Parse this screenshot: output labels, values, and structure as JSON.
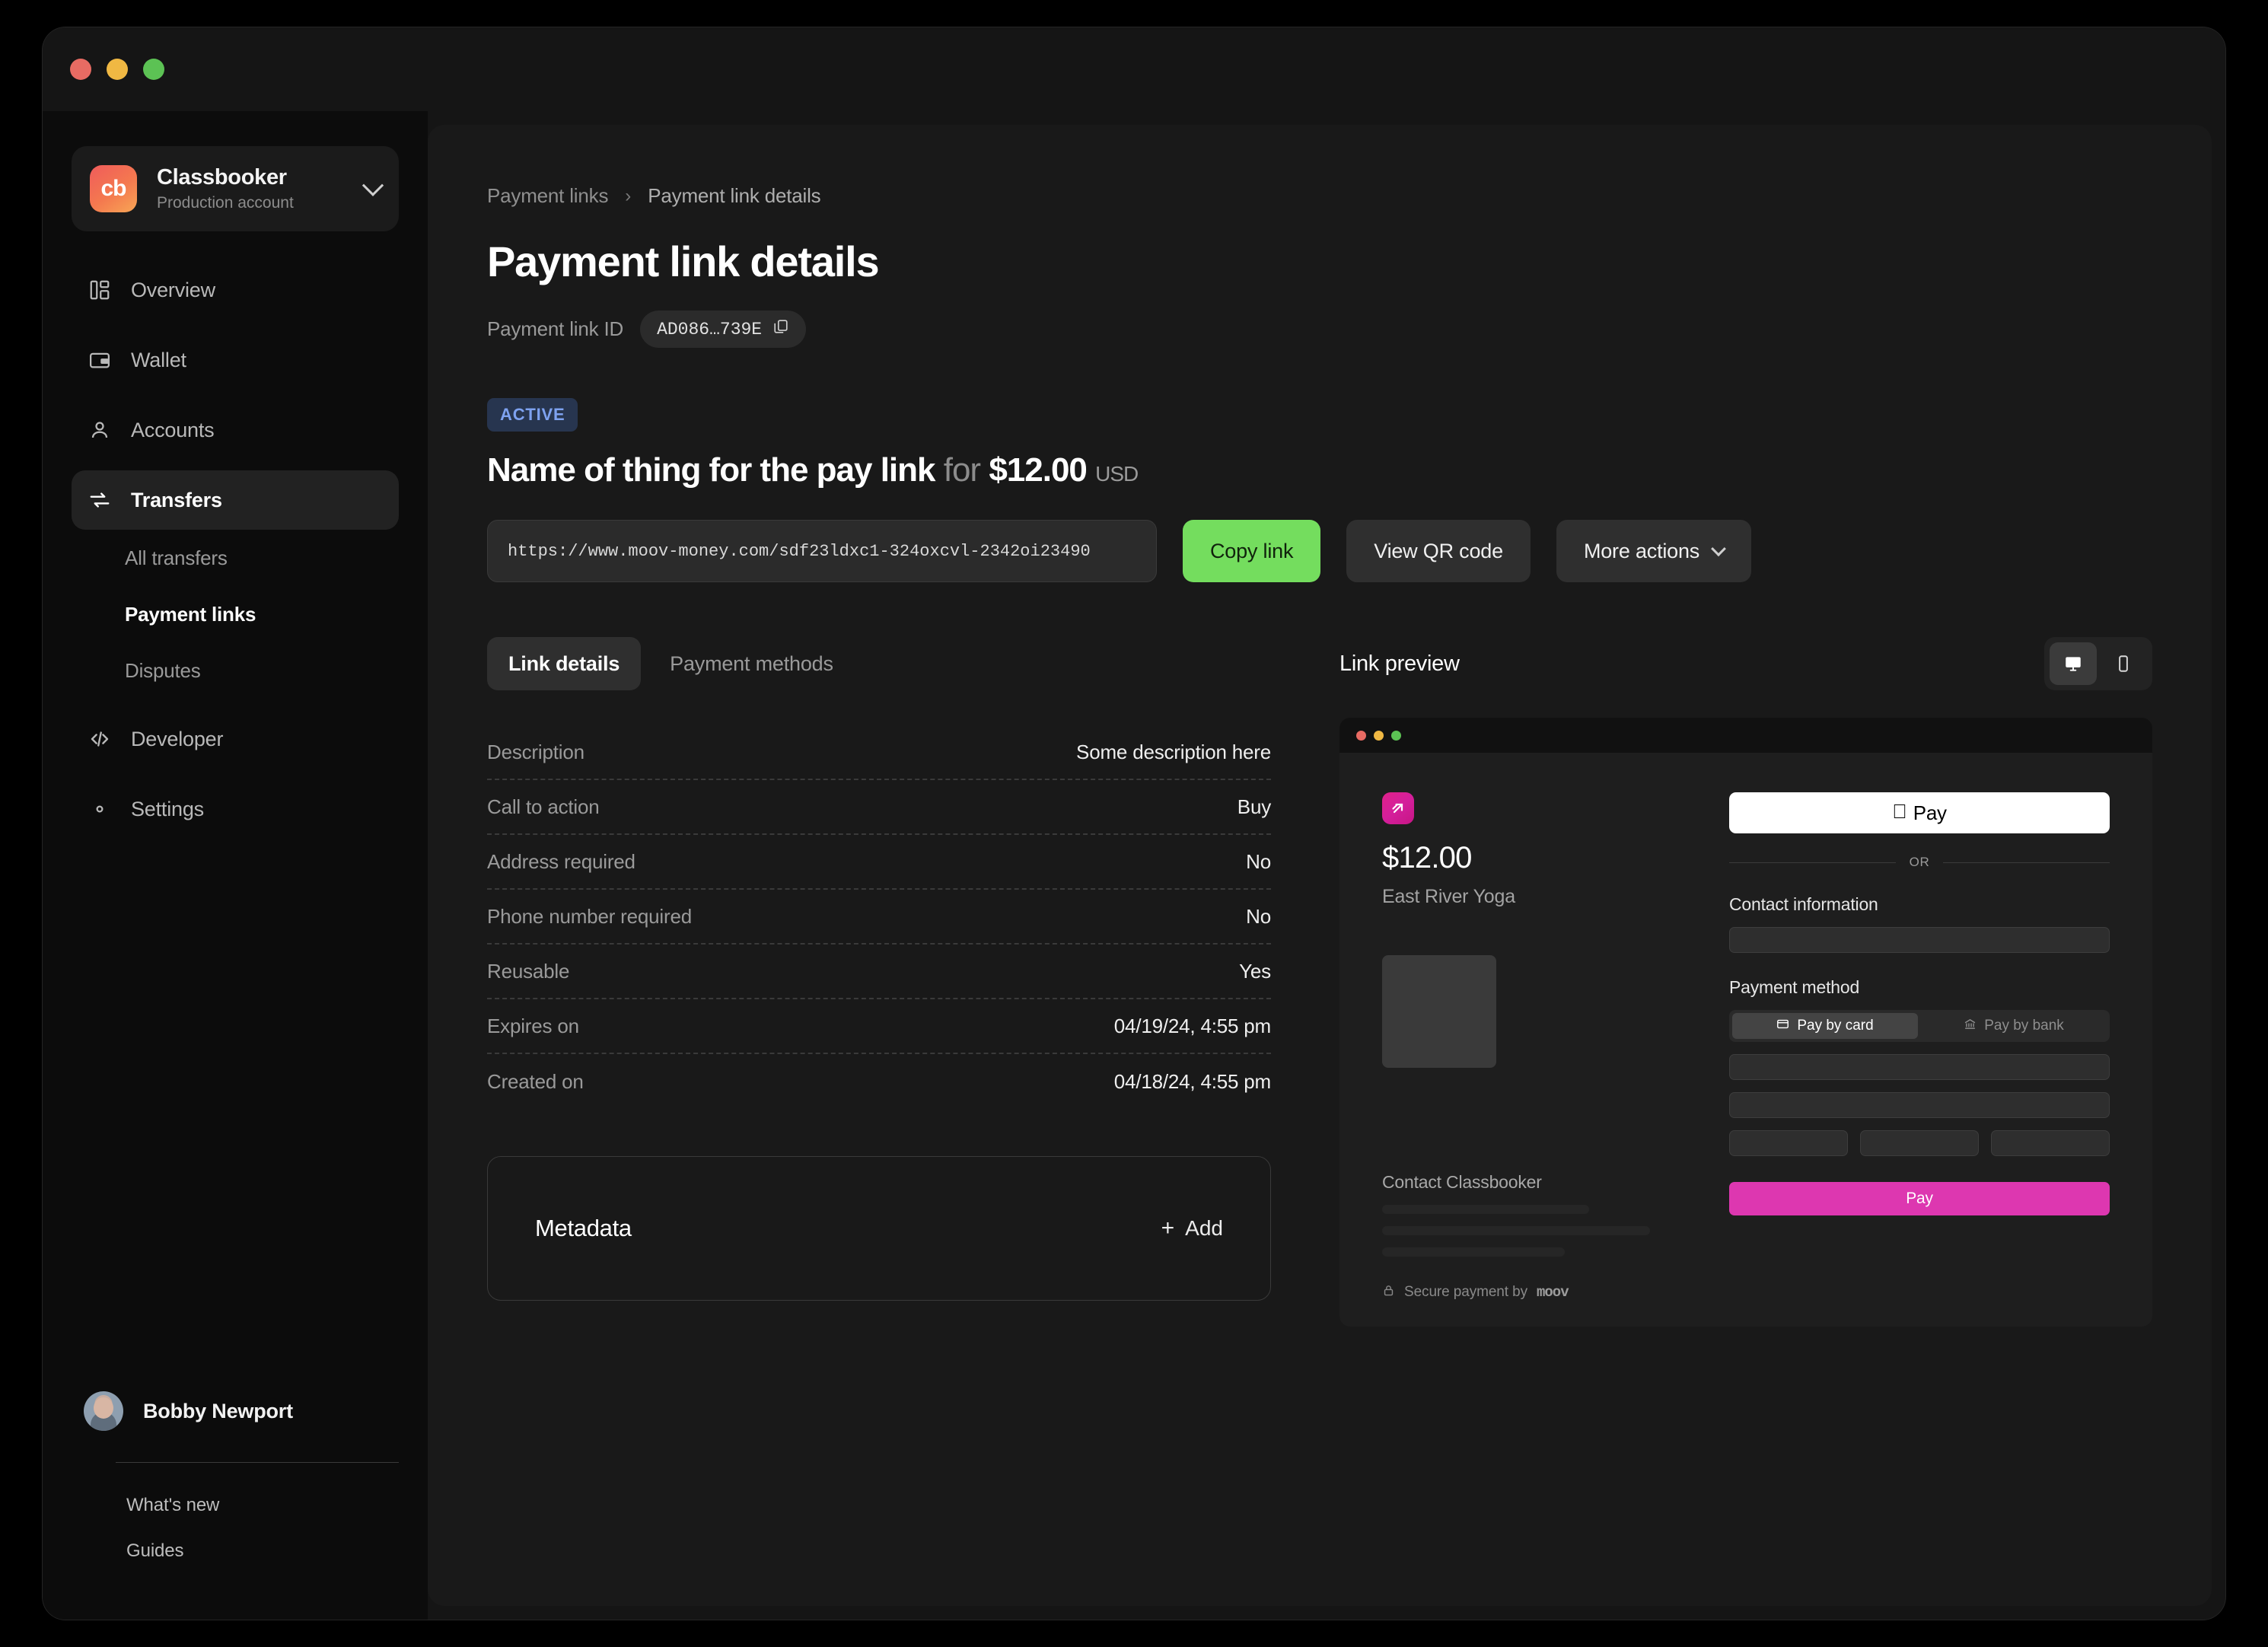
{
  "window": {
    "traffic_lights": [
      "close",
      "minimize",
      "zoom"
    ]
  },
  "sidebar": {
    "account": {
      "logo_text": "cb",
      "name": "Classbooker",
      "subtitle": "Production account"
    },
    "nav": [
      {
        "label": "Overview",
        "icon": "dashboard-icon",
        "active": false
      },
      {
        "label": "Wallet",
        "icon": "wallet-icon",
        "active": false
      },
      {
        "label": "Accounts",
        "icon": "person-icon",
        "active": false
      },
      {
        "label": "Transfers",
        "icon": "transfers-icon",
        "active": true
      }
    ],
    "sub_nav": [
      {
        "label": "All transfers",
        "current": false
      },
      {
        "label": "Payment links",
        "current": true
      },
      {
        "label": "Disputes",
        "current": false
      }
    ],
    "nav_bottom": [
      {
        "label": "Developer",
        "icon": "code-icon",
        "active": false
      },
      {
        "label": "Settings",
        "icon": "gear-icon",
        "active": false
      }
    ],
    "user": {
      "name": "Bobby Newport"
    },
    "footer_links": [
      "What's new",
      "Guides"
    ]
  },
  "main": {
    "breadcrumb": {
      "parent": "Payment links",
      "separator": "›",
      "current": "Payment link details"
    },
    "page_title": "Payment link details",
    "id_label": "Payment link ID",
    "id_value": "AD086…739E",
    "status_badge": "ACTIVE",
    "headline": {
      "name": "Name of thing for the pay link",
      "for_word": "for",
      "amount": "$12.00",
      "currency": "USD"
    },
    "url": "https://www.moov-money.com/sdf23ldxc1-324oxcvl-2342oi23490",
    "buttons": {
      "copy_link": "Copy link",
      "view_qr": "View QR code",
      "more_actions": "More actions"
    },
    "tabs": [
      {
        "label": "Link details",
        "active": true
      },
      {
        "label": "Payment methods",
        "active": false
      }
    ],
    "details": [
      {
        "key": "Description",
        "value": "Some description here"
      },
      {
        "key": "Call to action",
        "value": "Buy"
      },
      {
        "key": "Address required",
        "value": "No"
      },
      {
        "key": "Phone number required",
        "value": "No"
      },
      {
        "key": "Reusable",
        "value": "Yes"
      },
      {
        "key": "Expires on",
        "value": "04/19/24, 4:55 pm"
      },
      {
        "key": "Created on",
        "value": "04/18/24, 4:55 pm"
      }
    ],
    "metadata": {
      "title": "Metadata",
      "add_label": "Add",
      "add_symbol": "+"
    }
  },
  "preview": {
    "label": "Link preview",
    "devices": [
      {
        "name": "desktop",
        "active": true
      },
      {
        "name": "mobile",
        "active": false
      }
    ],
    "checkout": {
      "amount": "$12.00",
      "merchant": "East River Yoga",
      "apple_pay_label": "Pay",
      "or_label": "OR",
      "contact_information_label": "Contact information",
      "payment_method_label": "Payment method",
      "method_card": "Pay by card",
      "method_bank": "Pay by bank",
      "pay_button": "Pay",
      "contact_merchant_title": "Contact Classbooker",
      "secure_text": "Secure payment by",
      "secure_brand": "moov"
    }
  },
  "colors": {
    "accent_green": "#74dd5e",
    "accent_pink": "#dd37b0",
    "badge_bg": "#27354f",
    "badge_text": "#7ea2f0",
    "window_bg": "#151515",
    "main_bg": "#191919",
    "sidebar_bg": "#0c0c0c"
  }
}
